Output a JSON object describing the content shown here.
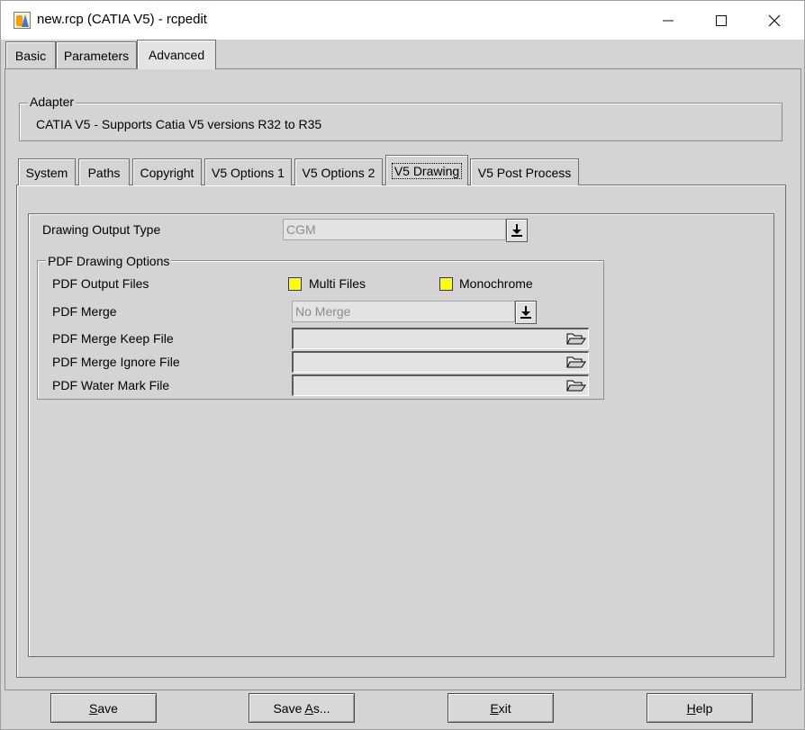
{
  "window": {
    "title": "new.rcp (CATIA V5) - rcpedit"
  },
  "top_tabs": [
    "Basic",
    "Parameters",
    "Advanced"
  ],
  "adapter": {
    "group_label": "Adapter",
    "text": "CATIA V5  -  Supports Catia V5 versions R32 to R35"
  },
  "inner_tabs": [
    "System",
    "Paths",
    "Copyright",
    "V5 Options 1",
    "V5 Options 2",
    "V5 Drawing",
    "V5 Post Process"
  ],
  "drawing": {
    "output_type_label": "Drawing Output Type",
    "output_type_value": "CGM",
    "pdf_group_label": "PDF Drawing Options",
    "pdf_output_files_label": "PDF Output Files",
    "multi_files_label": "Multi Files",
    "monochrome_label": "Monochrome",
    "pdf_merge_label": "PDF Merge",
    "pdf_merge_value": "No Merge",
    "keep_file_label": "PDF Merge Keep File",
    "ignore_file_label": "PDF Merge Ignore File",
    "watermark_label": "PDF Water Mark File",
    "keep_file_value": "",
    "ignore_file_value": "",
    "watermark_value": ""
  },
  "buttons": {
    "save": {
      "pre": "",
      "u": "S",
      "post": "ave"
    },
    "save_as": {
      "pre": "Save ",
      "u": "A",
      "post": "s..."
    },
    "exit": {
      "pre": "",
      "u": "E",
      "post": "xit"
    },
    "help": {
      "pre": "",
      "u": "H",
      "post": "elp"
    }
  },
  "colors": {
    "checkbox_fill": "#ffff00",
    "window_bg": "#d4d4d4"
  }
}
